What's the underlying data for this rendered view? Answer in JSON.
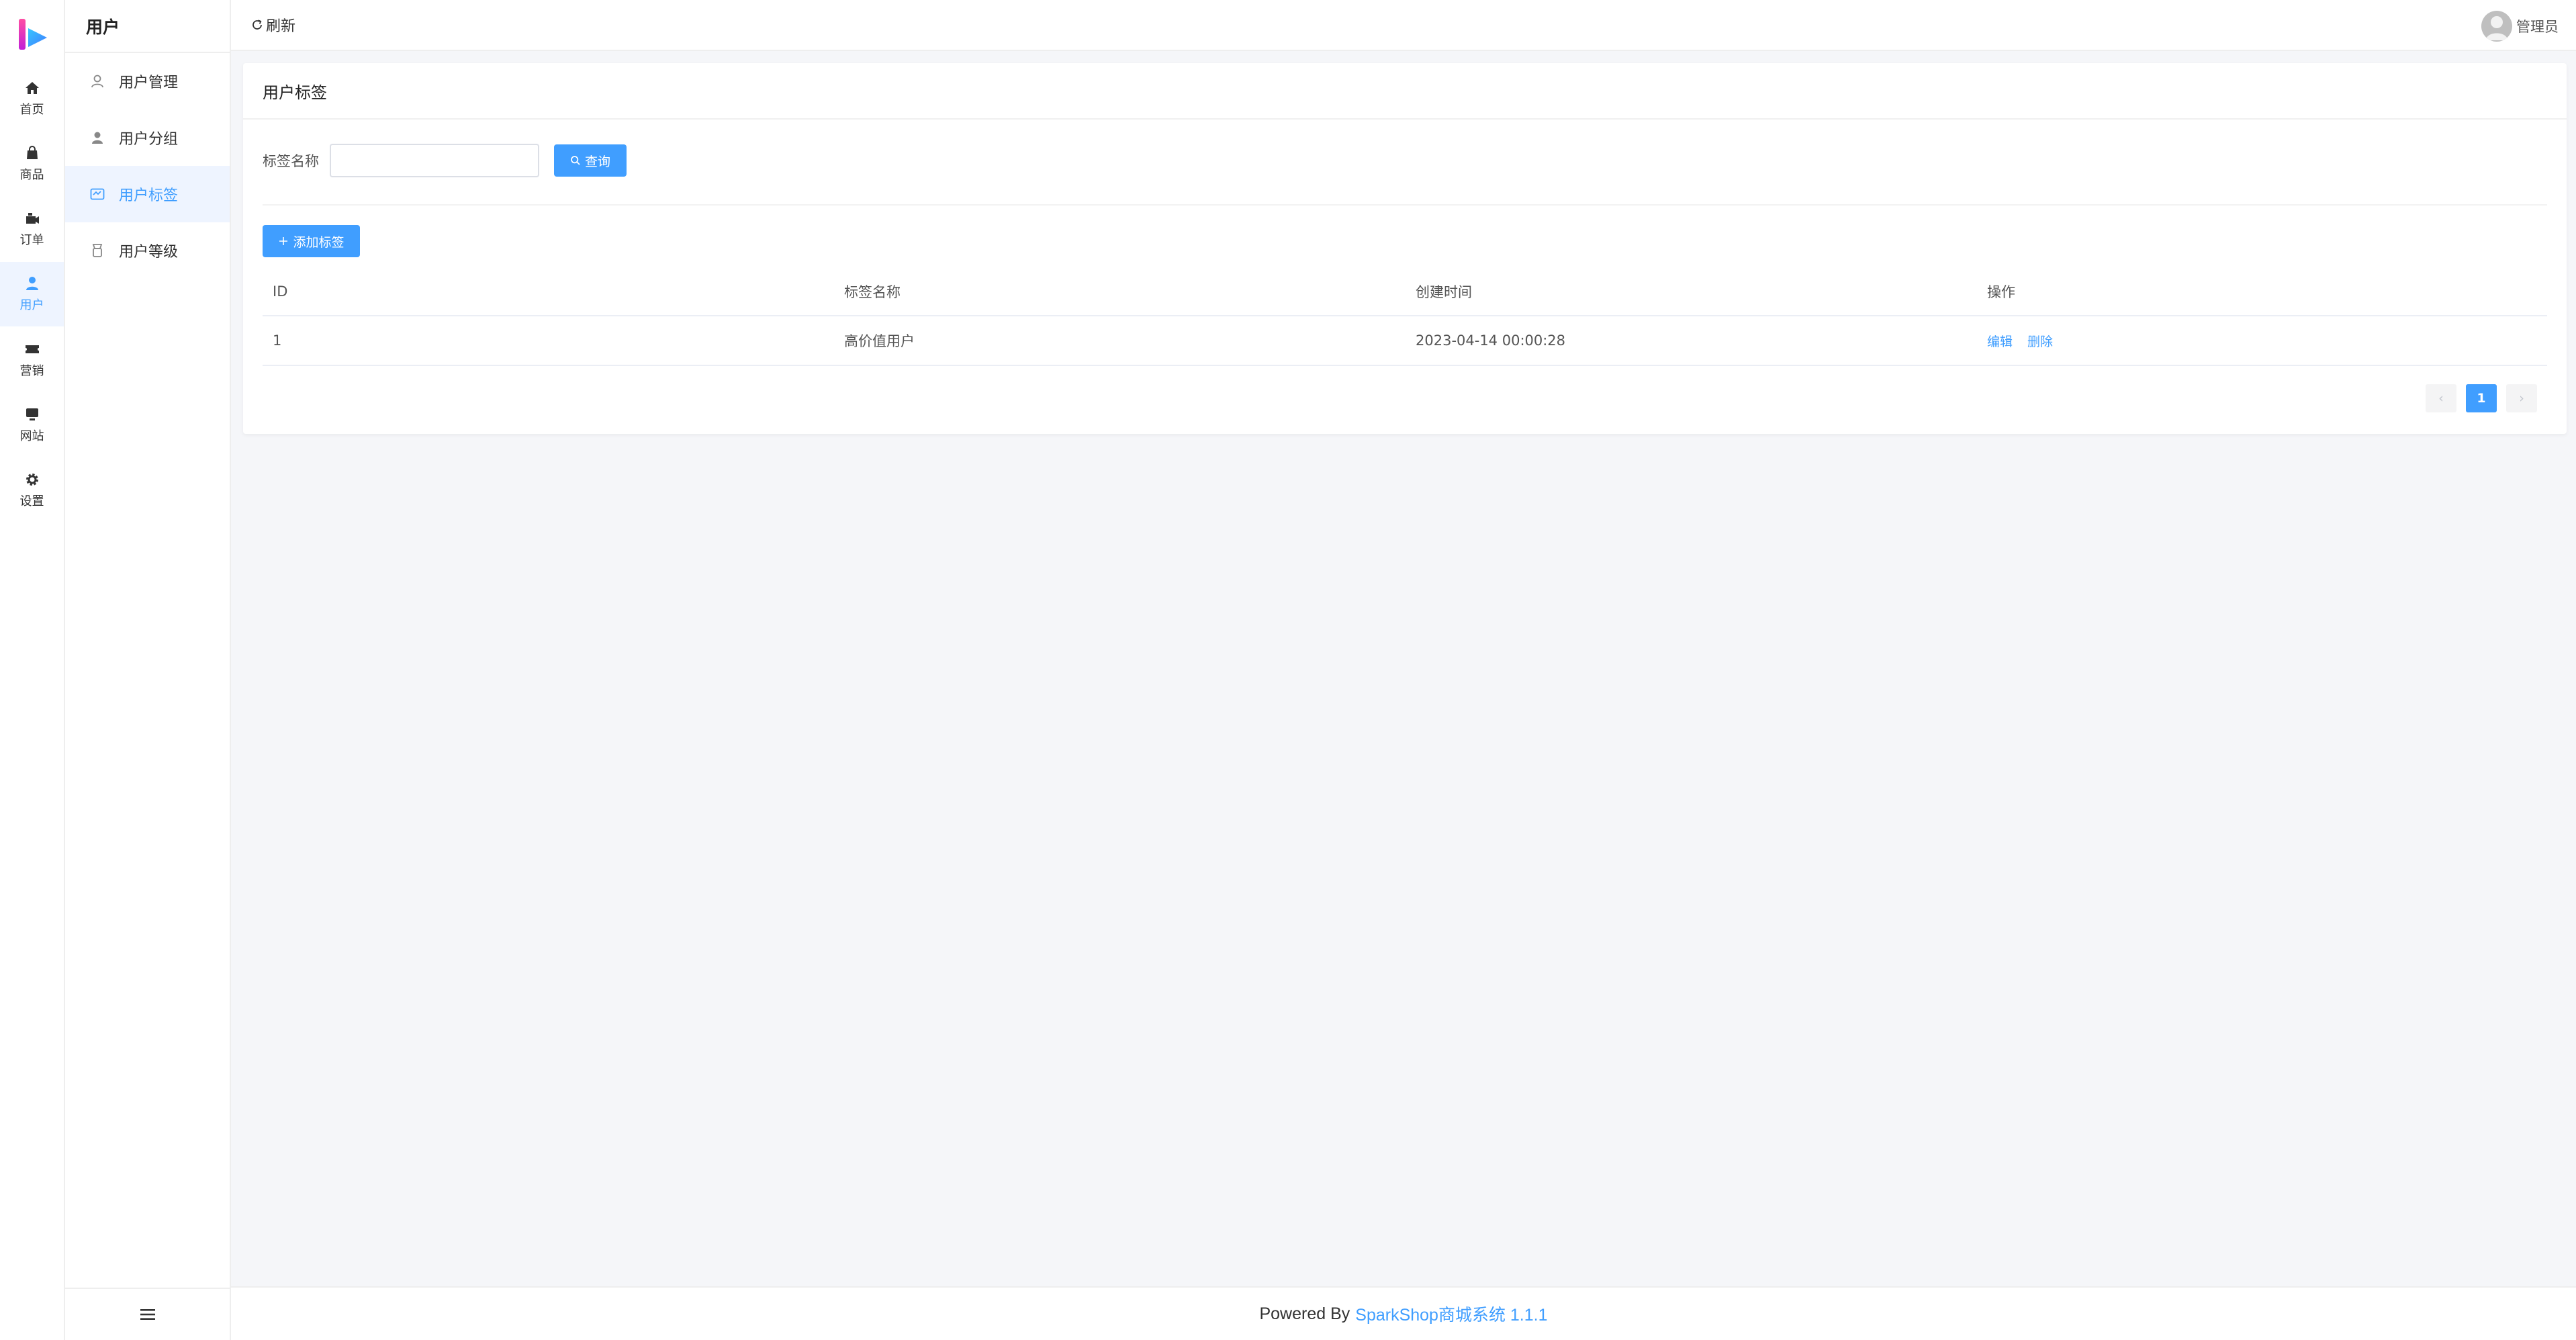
{
  "rail": {
    "items": [
      {
        "label": "首页"
      },
      {
        "label": "商品"
      },
      {
        "label": "订单"
      },
      {
        "label": "用户"
      },
      {
        "label": "营销"
      },
      {
        "label": "网站"
      },
      {
        "label": "设置"
      }
    ],
    "active_index": 3
  },
  "subnav": {
    "title": "用户",
    "items": [
      {
        "label": "用户管理"
      },
      {
        "label": "用户分组"
      },
      {
        "label": "用户标签"
      },
      {
        "label": "用户等级"
      }
    ],
    "active_index": 2
  },
  "topbar": {
    "refresh_label": "刷新",
    "user_name": "管理员"
  },
  "card": {
    "title": "用户标签",
    "search": {
      "label": "标签名称",
      "value": "",
      "placeholder": "",
      "query_button": "查询"
    },
    "add_button": "添加标签",
    "table": {
      "columns": [
        "ID",
        "标签名称",
        "创建时间",
        "操作"
      ],
      "rows": [
        {
          "id": "1",
          "name": "高价值用户",
          "created": "2023-04-14 00:00:28",
          "actions": [
            "编辑",
            "删除"
          ]
        }
      ]
    },
    "pagination": {
      "prev": "‹",
      "current": "1",
      "next": "›"
    }
  },
  "footer": {
    "prefix": "Powered By",
    "brand": "SparkShop商城系统 1.1.1"
  },
  "colors": {
    "primary": "#409eff",
    "active_bg": "#eef4ff",
    "page_bg": "#f5f6f9"
  }
}
